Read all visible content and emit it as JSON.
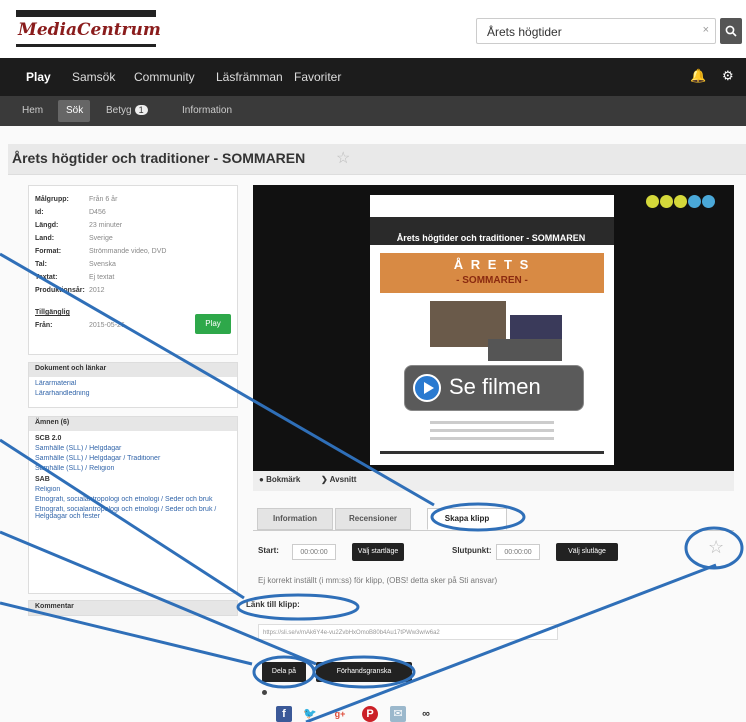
{
  "header": {
    "logo_text": "MediaCentrum",
    "search_value": "Årets högtider",
    "search_clear": "×",
    "search_button": "Q"
  },
  "nav_primary": {
    "items": [
      "Play",
      "Samsök",
      "Community",
      "Läsfrämman",
      "Favoriter"
    ],
    "bell_icon": "bell-icon",
    "gear_icon": "gear-icon"
  },
  "nav_secondary": {
    "items": [
      "Hem",
      "Sök",
      "Betyg",
      "Information"
    ],
    "badge": "1"
  },
  "page": {
    "title": "Årets högtider och traditioner - SOMMAREN",
    "star": "☆"
  },
  "info": {
    "rows": [
      {
        "k": "Målgrupp:",
        "v": "Från 6 år"
      },
      {
        "k": "Id:",
        "v": "D456"
      },
      {
        "k": "Längd:",
        "v": "23 minuter"
      },
      {
        "k": "Land:",
        "v": "Sverige"
      },
      {
        "k": "Format:",
        "v": "Strömmande video, DVD"
      },
      {
        "k": "Tal:",
        "v": "Svenska"
      },
      {
        "k": "Textat:",
        "v": "Ej textat"
      },
      {
        "k": "Produktionsår:",
        "v": "2012"
      },
      {
        "k": "Tillgänglig",
        "v": ""
      },
      {
        "k": "Från:",
        "v": "2015-05-26"
      }
    ],
    "play_button": "Play"
  },
  "documents": {
    "title": "Dokument och länkar",
    "links": [
      "Lärarmaterial",
      "Lärarhandledning"
    ]
  },
  "subjects": {
    "title": "Ämnen (6)",
    "groups": [
      {
        "name": "SCB 2.0",
        "links": [
          "Samhälle (SLL) / Helgdagar",
          "Samhälle (SLL) / Helgdagar / Traditioner",
          "Samhälle (SLL) / Religion"
        ]
      },
      {
        "name": "SAB",
        "links": [
          "Religion",
          "Etnografi, socialantropologi och etnologi / Seder och bruk",
          "Etnografi, socialantropologi och etnologi / Seder och bruk / Helgdagar och fester"
        ]
      }
    ]
  },
  "comments": {
    "title": "Kommentar"
  },
  "video": {
    "title": "Årets högtider och traditioner - SOMMAREN",
    "poster_heading": "Å R E T S",
    "poster_sub": "- SOMMAREN -",
    "play_label": "Se filmen",
    "controls": [
      "Bokmärk",
      "Avsnitt"
    ]
  },
  "tabs": [
    "Information",
    "Recensioner",
    "Skapa klipp"
  ],
  "clip": {
    "start_label": "Start:",
    "start_value": "00:00:00",
    "start_button": "Välj startläge",
    "stop_label": "Slutpunkt:",
    "stop_value": "00:00:00",
    "stop_button": "Välj slutläge",
    "star": "☆",
    "note": "Ej korrekt inställt (i mm:ss) för klipp, (OBS! detta sker på Sti ansvar)",
    "link_label": "Länk till klipp:",
    "link_value": "https://sli.se/v/mAk6Y4e-vu2ZvbHxOmoB80b4Au17tPWw3w/w6a2",
    "share_button": "Dela på",
    "preview_button": "Förhandsgranska"
  },
  "share": {
    "icons": [
      "facebook-icon",
      "twitter-icon",
      "googleplus-icon",
      "pinterest-icon",
      "mail-icon",
      "link-icon"
    ]
  },
  "colors": {
    "accent_green": "#2ea84a",
    "annotation_blue": "#2f6fb8",
    "nav_dark": "#1c1c1c"
  }
}
